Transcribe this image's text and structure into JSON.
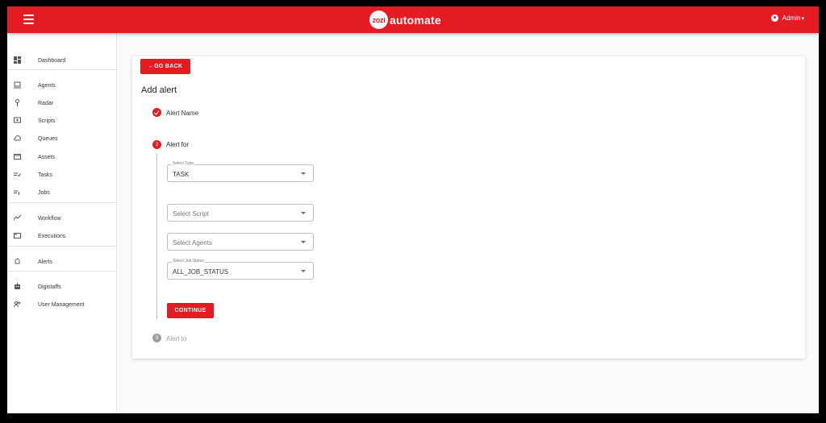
{
  "header": {
    "brand_badge": "zozi",
    "brand_text": "automate",
    "user_label": "Admin",
    "accent_color": "#e41b23"
  },
  "sidebar": {
    "items": [
      {
        "label": "Dashboard",
        "icon": "dashboard-icon"
      },
      {
        "label": "Agents",
        "icon": "laptop-icon"
      },
      {
        "label": "Radar",
        "icon": "radar-icon"
      },
      {
        "label": "Scripts",
        "icon": "script-icon"
      },
      {
        "label": "Queues",
        "icon": "cloud-icon"
      },
      {
        "label": "Assets",
        "icon": "folder-icon"
      },
      {
        "label": "Tasks",
        "icon": "tasks-icon"
      },
      {
        "label": "Jobs",
        "icon": "jobs-icon"
      },
      {
        "label": "Workflow",
        "icon": "workflow-icon"
      },
      {
        "label": "Executions",
        "icon": "executions-icon"
      },
      {
        "label": "Alerts",
        "icon": "bell-icon"
      },
      {
        "label": "Digistaffs",
        "icon": "robot-icon"
      },
      {
        "label": "User Management",
        "icon": "users-icon"
      }
    ]
  },
  "main": {
    "go_back_label": "←GO BACK",
    "title": "Add alert",
    "steps": [
      {
        "number": "1",
        "label": "Alert Name",
        "state": "completed"
      },
      {
        "number": "2",
        "label": "Alert for",
        "state": "active"
      },
      {
        "number": "3",
        "label": "Alert to",
        "state": "inactive"
      }
    ],
    "fields": {
      "type": {
        "legend": "Select Type",
        "value": "TASK"
      },
      "script": {
        "placeholder": "Select Script"
      },
      "agents": {
        "placeholder": "Select Agents"
      },
      "job_status": {
        "legend": "Select Job Status",
        "value": "ALL_JOB_STATUS"
      }
    },
    "continue_label": "CONTINUE"
  }
}
